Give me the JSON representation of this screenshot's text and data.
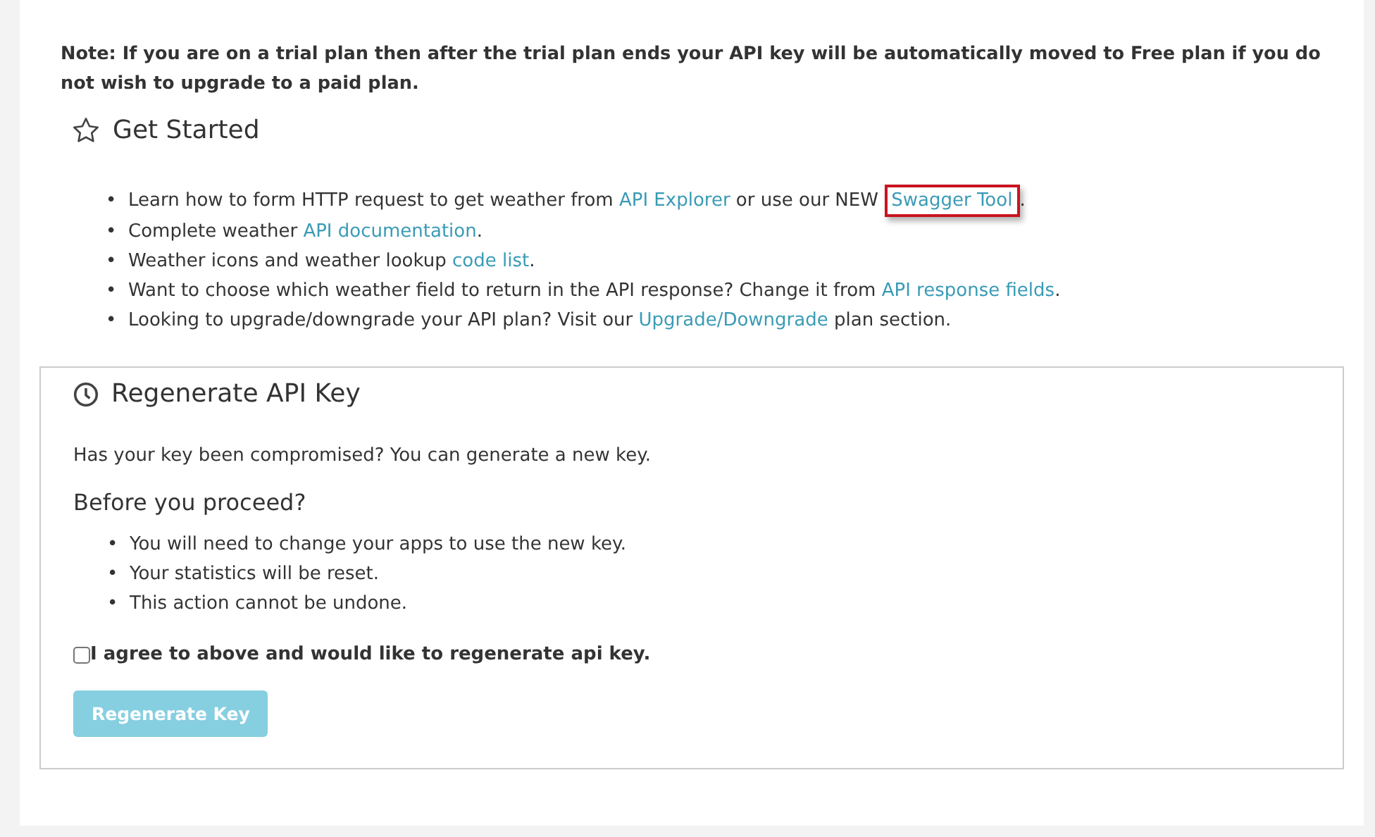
{
  "note": "Note: If you are on a trial plan then after the trial plan ends your API key will be automatically moved to Free plan if you do not wish to upgrade to a paid plan.",
  "get_started": {
    "title": "Get Started",
    "items": [
      {
        "marker": "•",
        "parts": [
          {
            "kind": "text",
            "text": "Learn how to form HTTP request to get weather from "
          },
          {
            "kind": "link",
            "text": "API Explorer",
            "highlighted": false
          },
          {
            "kind": "text",
            "text": " or use our NEW "
          },
          {
            "kind": "link",
            "text": "Swagger Tool",
            "highlighted": true
          },
          {
            "kind": "text",
            "text": "."
          }
        ]
      },
      {
        "marker": "•",
        "parts": [
          {
            "kind": "text",
            "text": "Complete weather "
          },
          {
            "kind": "link",
            "text": "API documentation",
            "highlighted": false
          },
          {
            "kind": "text",
            "text": "."
          }
        ]
      },
      {
        "marker": "•",
        "parts": [
          {
            "kind": "text",
            "text": "Weather icons and weather lookup "
          },
          {
            "kind": "link",
            "text": "code list",
            "highlighted": false
          },
          {
            "kind": "text",
            "text": "."
          }
        ]
      },
      {
        "marker": "•",
        "parts": [
          {
            "kind": "text",
            "text": "Want to choose which weather field to return in the API response? Change it from "
          },
          {
            "kind": "link",
            "text": "API response fields",
            "highlighted": false
          },
          {
            "kind": "text",
            "text": "."
          }
        ]
      },
      {
        "marker": "•",
        "parts": [
          {
            "kind": "text",
            "text": "Looking to upgrade/downgrade your API plan? Visit our "
          },
          {
            "kind": "link",
            "text": "Upgrade/Downgrade",
            "highlighted": false
          },
          {
            "kind": "text",
            "text": " plan section."
          }
        ]
      }
    ]
  },
  "regenerate": {
    "title": "Regenerate API Key",
    "intro": "Has your key been compromised? You can generate a new key.",
    "subtitle": "Before you proceed?",
    "items": [
      {
        "marker": "•",
        "text": "You will need to change your apps to use the new key."
      },
      {
        "marker": "•",
        "text": "Your statistics will be reset."
      },
      {
        "marker": "•",
        "text": "This action cannot be undone."
      }
    ],
    "agree": {
      "label": "I agree to above and would like to regenerate api key.",
      "checked": false
    },
    "button": {
      "label": "Regenerate Key",
      "disabled": true
    }
  }
}
